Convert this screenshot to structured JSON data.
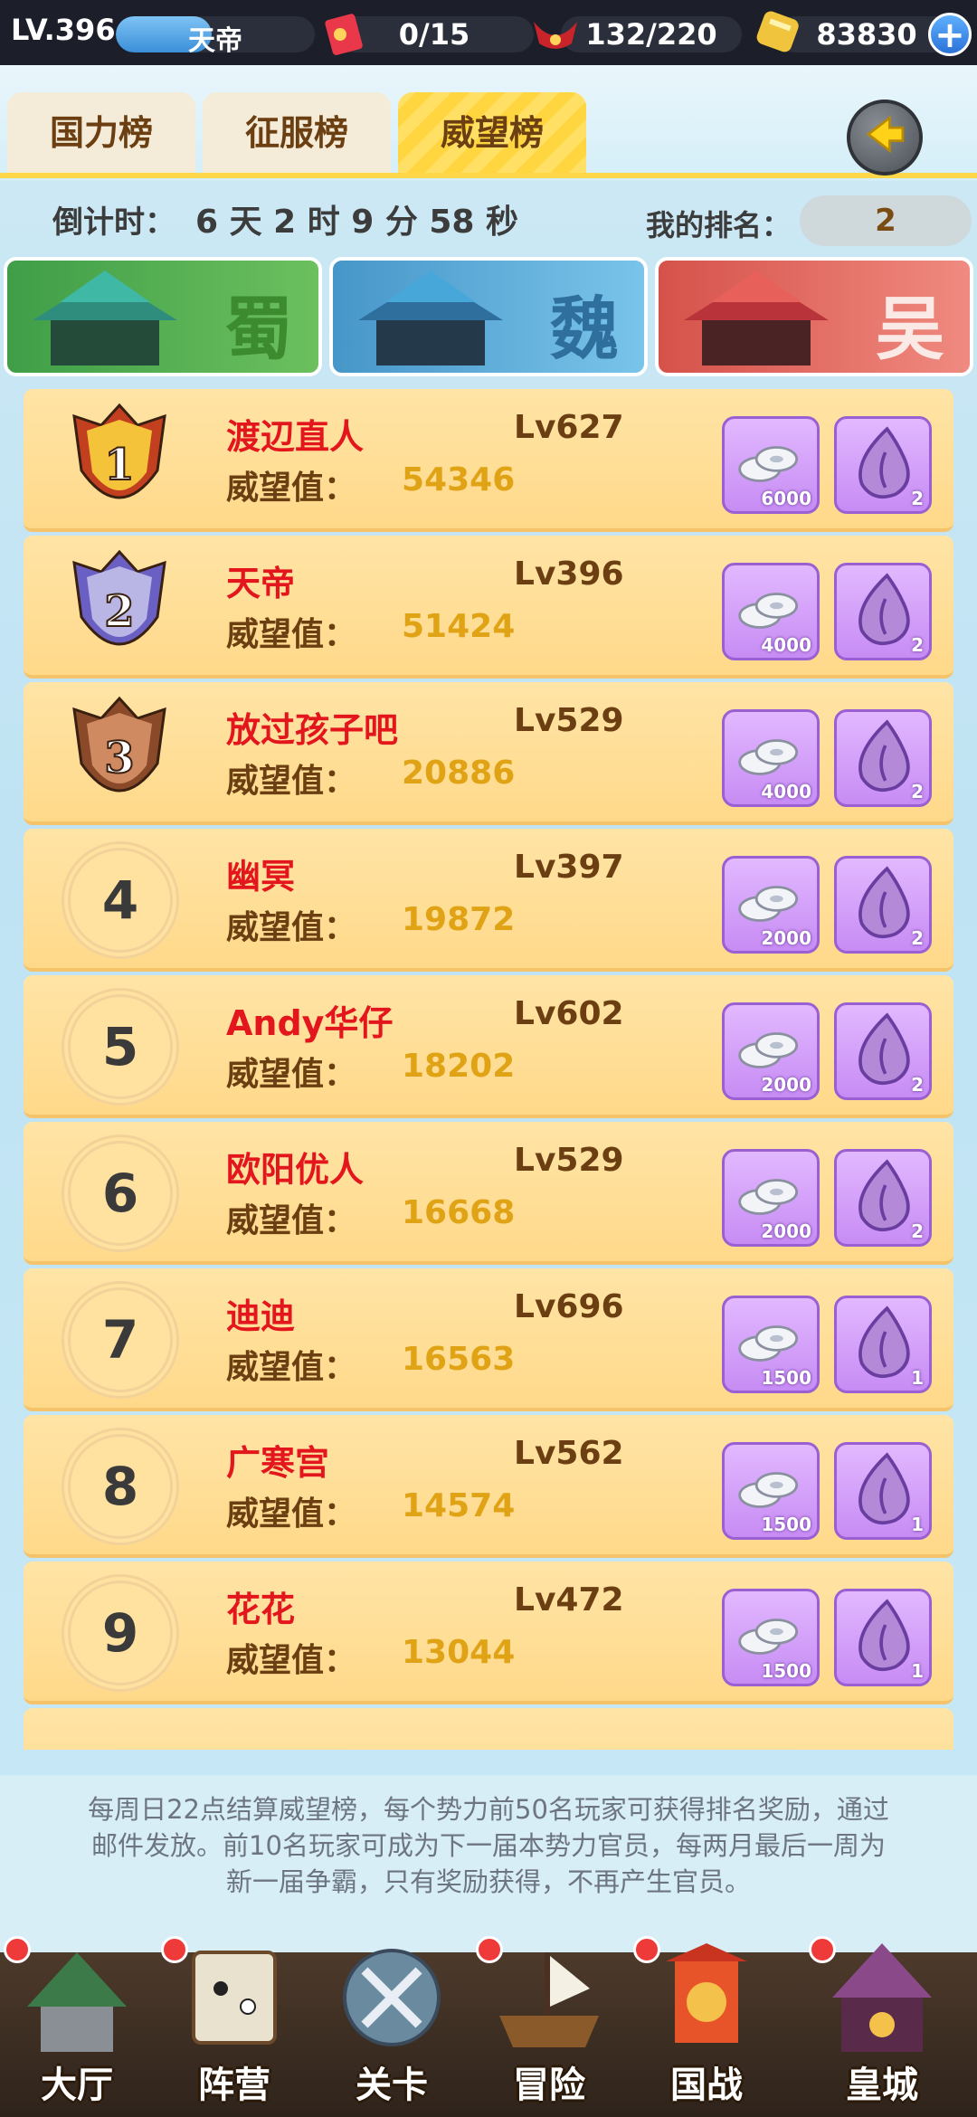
{
  "topbar": {
    "level": "LV.396",
    "player_name": "天帝",
    "exp_progress": 0.48,
    "tickets": "0/15",
    "stamina": "132/220",
    "gold": "83830",
    "plus_icon": "plus-icon"
  },
  "tabs": [
    {
      "label": "国力榜",
      "active": false
    },
    {
      "label": "征服榜",
      "active": false
    },
    {
      "label": "威望榜",
      "active": true
    }
  ],
  "countdown": {
    "label": "倒计时：",
    "value": "6 天 2 时 9 分 58 秒"
  },
  "my_rank": {
    "label": "我的排名：",
    "value": "2"
  },
  "factions": [
    {
      "name": "蜀",
      "color": "#4fb04a"
    },
    {
      "name": "魏",
      "color": "#4aa5d6"
    },
    {
      "name": "吴",
      "color": "#e0605a"
    }
  ],
  "value_label": "威望值：",
  "rows": [
    {
      "rank": "1",
      "name": "渡辺直人",
      "level": "Lv627",
      "value": "54346",
      "reward1": "6000",
      "reward2": "2"
    },
    {
      "rank": "2",
      "name": "天帝",
      "level": "Lv396",
      "value": "51424",
      "reward1": "4000",
      "reward2": "2"
    },
    {
      "rank": "3",
      "name": "放过孩子吧",
      "level": "Lv529",
      "value": "20886",
      "reward1": "4000",
      "reward2": "2"
    },
    {
      "rank": "4",
      "name": "幽冥",
      "level": "Lv397",
      "value": "19872",
      "reward1": "2000",
      "reward2": "2"
    },
    {
      "rank": "5",
      "name": "Andy华仔",
      "level": "Lv602",
      "value": "18202",
      "reward1": "2000",
      "reward2": "2"
    },
    {
      "rank": "6",
      "name": "欧阳优人",
      "level": "Lv529",
      "value": "16668",
      "reward1": "2000",
      "reward2": "2"
    },
    {
      "rank": "7",
      "name": "迪迪",
      "level": "Lv696",
      "value": "16563",
      "reward1": "1500",
      "reward2": "1"
    },
    {
      "rank": "8",
      "name": "广寒宫",
      "level": "Lv562",
      "value": "14574",
      "reward1": "1500",
      "reward2": "1"
    },
    {
      "rank": "9",
      "name": "花花",
      "level": "Lv472",
      "value": "13044",
      "reward1": "1500",
      "reward2": "1"
    }
  ],
  "info": "每周日22点结算威望榜，每个势力前50名玩家可获得排名奖励，通过邮件发放。前10名玩家可成为下一届本势力官员，每两月最后一周为新一届争霸，只有奖励获得，不再产生官员。",
  "nav": [
    {
      "label": "大厅",
      "dot": true
    },
    {
      "label": "阵营",
      "dot": true
    },
    {
      "label": "关卡",
      "dot": false
    },
    {
      "label": "冒险",
      "dot": true
    },
    {
      "label": "国战",
      "dot": true
    },
    {
      "label": "皇城",
      "dot": true
    }
  ]
}
